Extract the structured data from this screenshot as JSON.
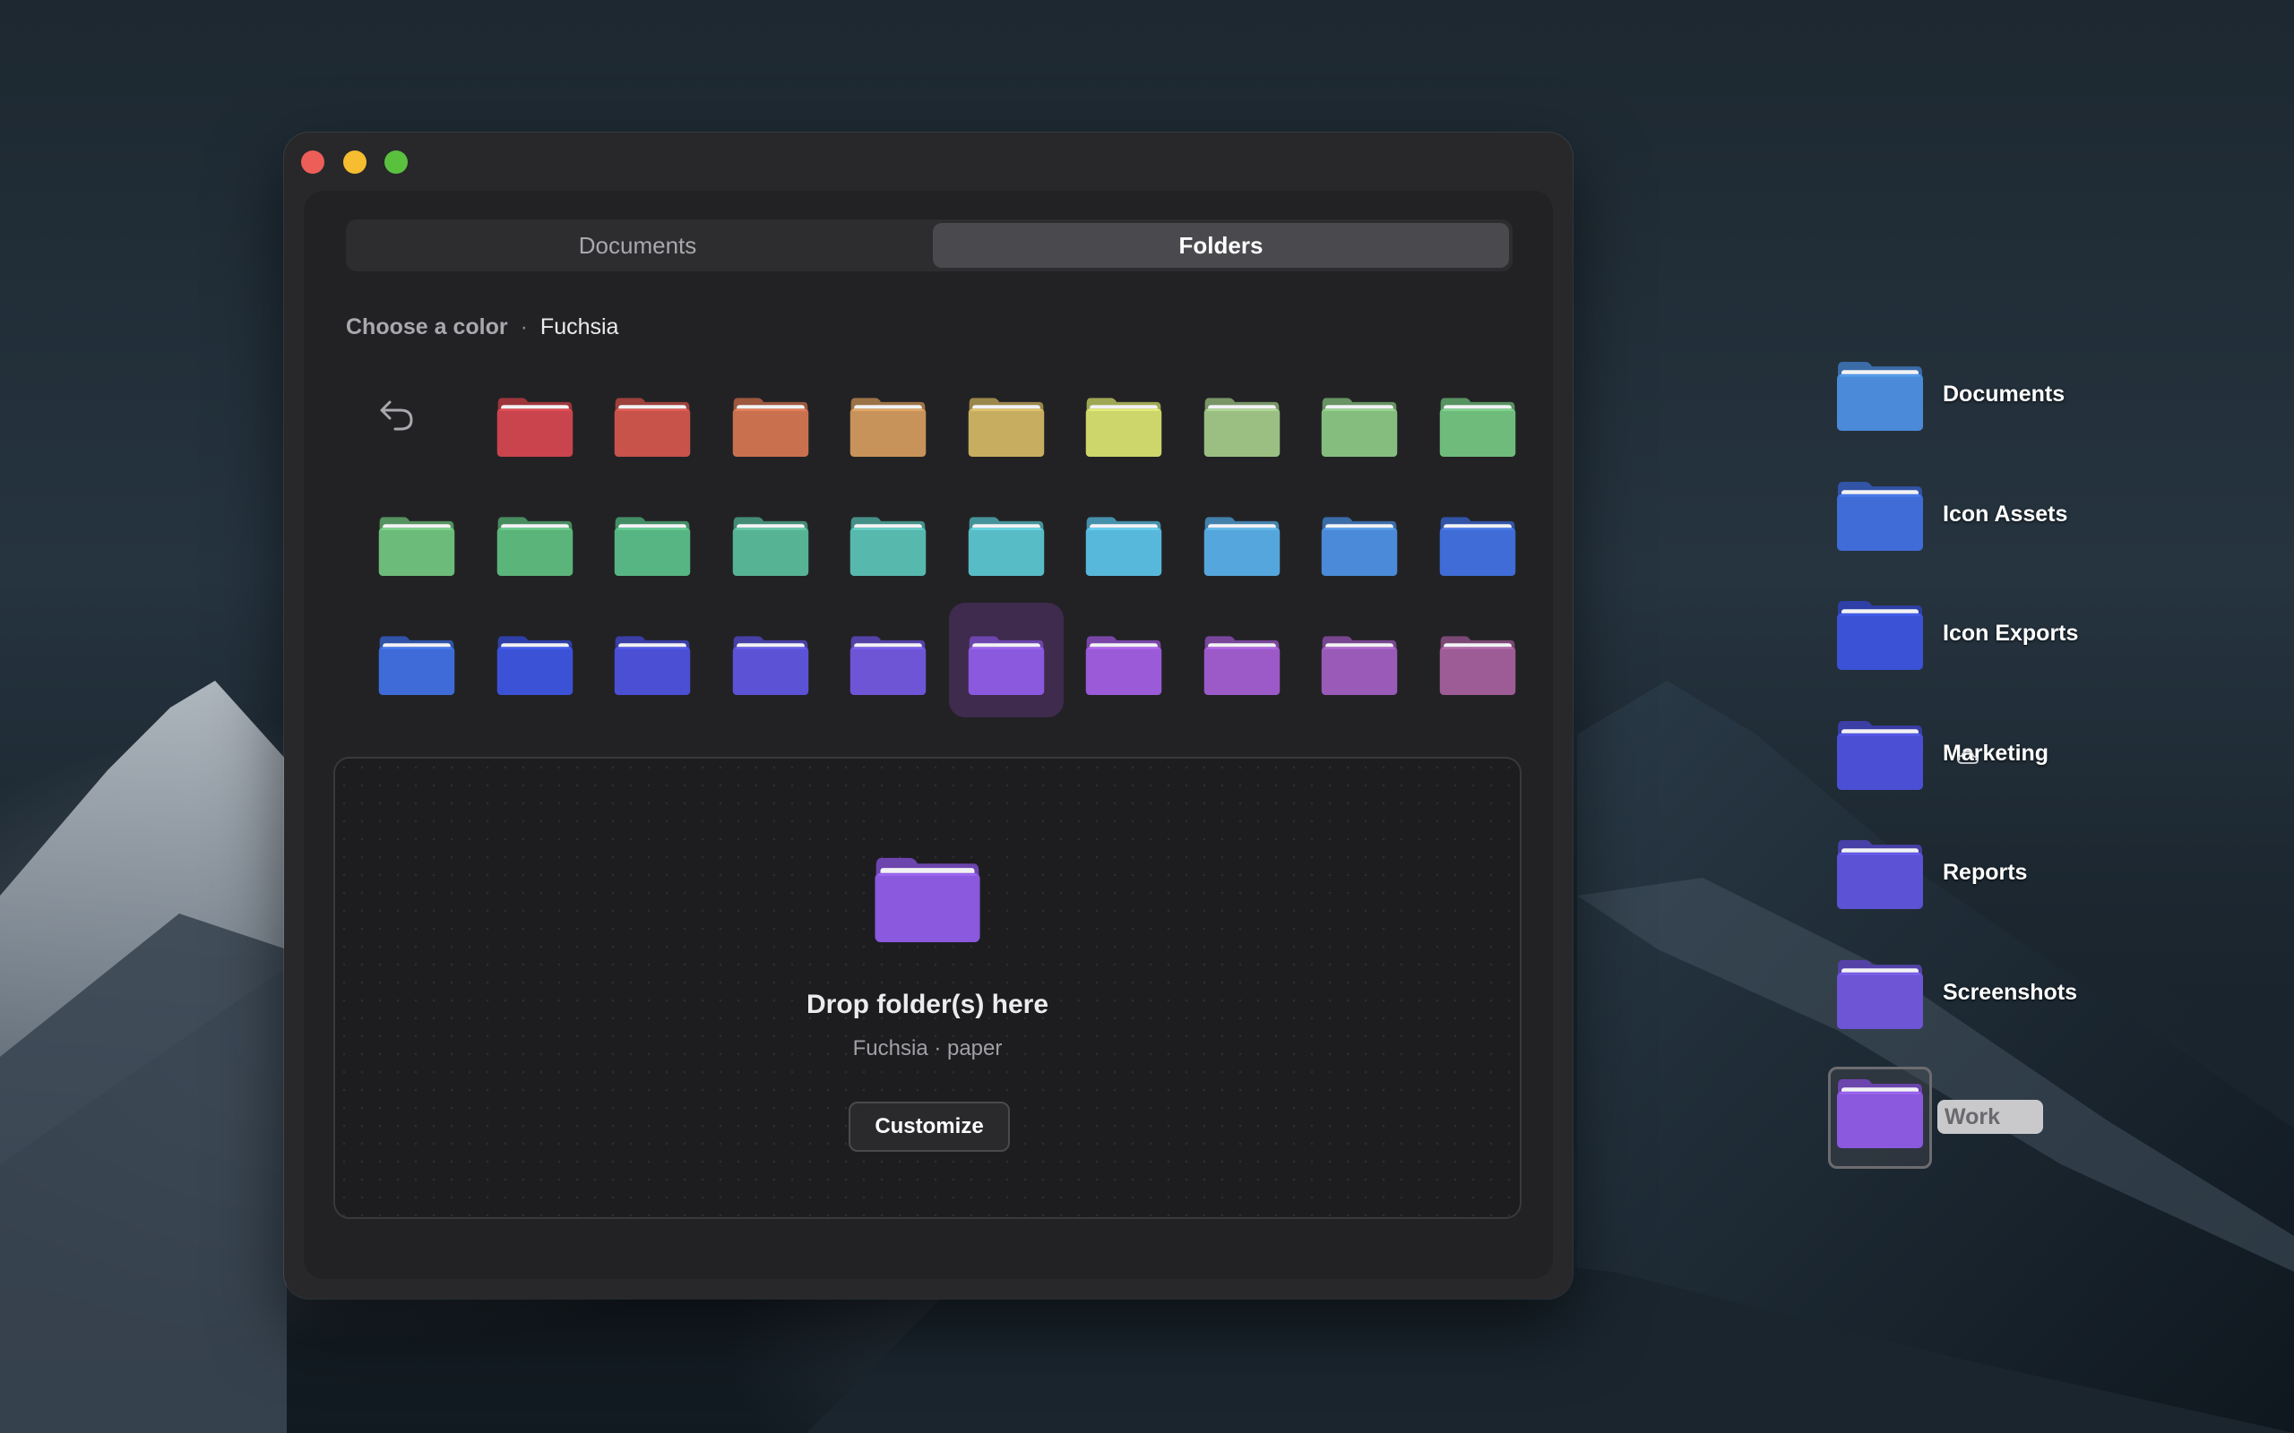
{
  "window": {
    "controls": [
      "close",
      "minimize",
      "maximize"
    ]
  },
  "tabs": [
    {
      "label": "Documents",
      "selected": false
    },
    {
      "label": "Folders",
      "selected": true
    }
  ],
  "color_picker": {
    "label": "Choose a color",
    "separator": "·",
    "selected_name": "Fuchsia",
    "reset_icon": "undo-icon",
    "swatches": [
      [
        "reset",
        "#c9444c",
        "#c8534b",
        "#c9714f",
        "#c8935a",
        "#c7ad60",
        "#ccd66a",
        "#9bbf83",
        "#85bd7f",
        "#6fbb7c"
      ],
      [
        "#6dbb7a",
        "#5bb47a",
        "#56b582",
        "#56b393",
        "#57b8ae",
        "#58bcc6",
        "#58b8dc",
        "#55a6dc",
        "#4a8ad8",
        "#3f6cd6"
      ],
      [
        "#3e6bd8",
        "#3b52d6",
        "#4a4fd4",
        "#5b52d5",
        "#6d55d6",
        "#8a59de",
        "#9b5ad8",
        "#9c5ac8",
        "#9a5ab8",
        "#9e5c96"
      ]
    ],
    "selected_index": 25
  },
  "drop_zone": {
    "title": "Drop folder(s) here",
    "subtitle": "Fuchsia · paper",
    "customize_label": "Customize",
    "folder_color": "#8a59de"
  },
  "desktop": {
    "items": [
      {
        "label": "Documents",
        "color": "#4a8ad8"
      },
      {
        "label": "Icon Assets",
        "color": "#3f6cd6"
      },
      {
        "label": "Icon Exports",
        "color": "#3b52d6"
      },
      {
        "label": "Marketing",
        "color": "#4a4fd4",
        "cloud": true,
        "cloud_icon": "cloud-icon"
      },
      {
        "label": "Reports",
        "color": "#5b52d5"
      },
      {
        "label": "Screenshots",
        "color": "#6d55d6"
      },
      {
        "label": "Work",
        "color": "#8a59de",
        "renaming": true
      }
    ]
  }
}
